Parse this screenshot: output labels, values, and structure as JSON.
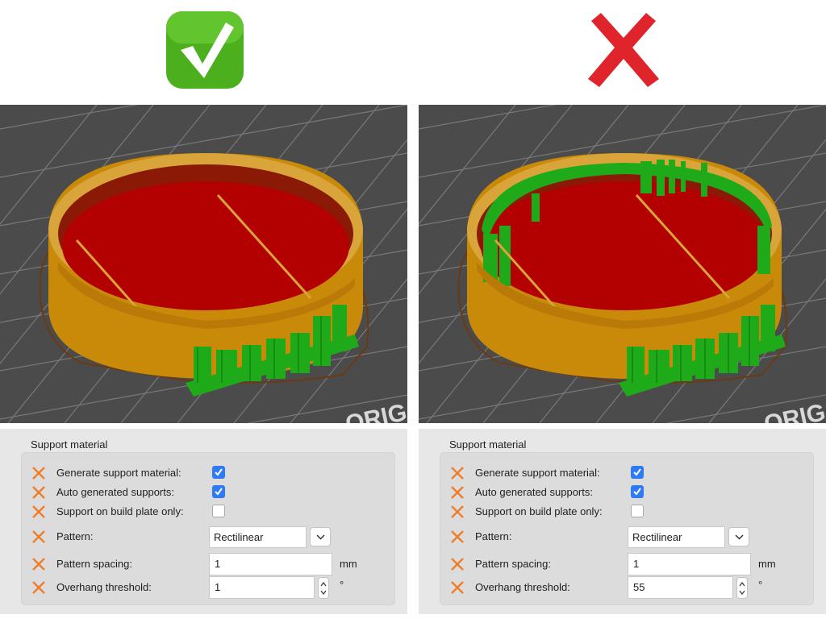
{
  "left": {
    "verdict_icon": "check-mark-icon",
    "section_title": "Support material",
    "rows": {
      "generate": {
        "label": "Generate support material:",
        "checked": true
      },
      "auto": {
        "label": "Auto generated supports:",
        "checked": true
      },
      "buildplate": {
        "label": "Support on build plate only:",
        "checked": false
      },
      "pattern": {
        "label": "Pattern:",
        "value": "Rectilinear"
      },
      "spacing": {
        "label": "Pattern spacing:",
        "value": "1",
        "unit": "mm"
      },
      "threshold": {
        "label": "Overhang threshold:",
        "value": "1",
        "unit": "°"
      }
    }
  },
  "right": {
    "verdict_icon": "cross-mark-icon",
    "section_title": "Support material",
    "rows": {
      "generate": {
        "label": "Generate support material:",
        "checked": true
      },
      "auto": {
        "label": "Auto generated supports:",
        "checked": true
      },
      "buildplate": {
        "label": "Support on build plate only:",
        "checked": false
      },
      "pattern": {
        "label": "Pattern:",
        "value": "Rectilinear"
      },
      "spacing": {
        "label": "Pattern spacing:",
        "value": "1",
        "unit": "mm"
      },
      "threshold": {
        "label": "Overhang threshold:",
        "value": "55",
        "unit": "°"
      }
    }
  },
  "viewport": {
    "bed_logo_text": "ORIG"
  },
  "colors": {
    "check_green": "#4caf1e",
    "cross_red": "#e0242b",
    "accent_blue": "#2f7bf5",
    "reset_orange": "#f07d2a",
    "perimeter": "#c98a0a",
    "infill": "#b30000",
    "support": "#1faa1a"
  }
}
